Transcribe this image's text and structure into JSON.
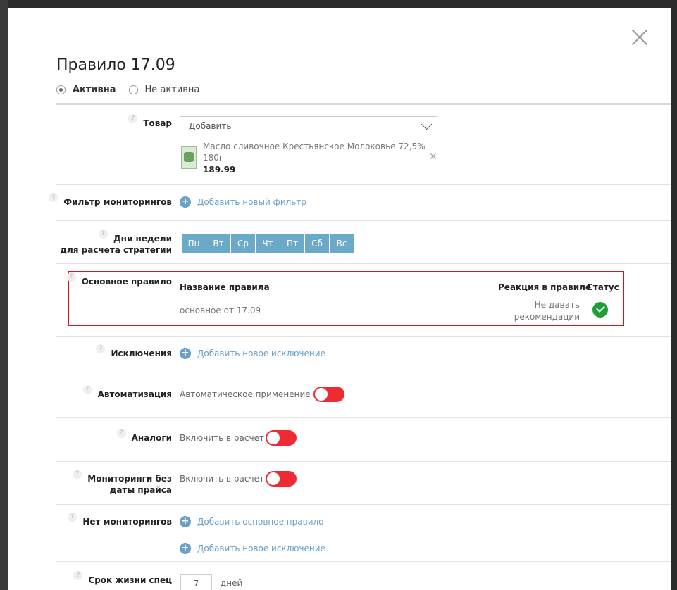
{
  "modal": {
    "title": "Правило 17.09",
    "status_options": [
      {
        "label": "Активна",
        "selected": true
      },
      {
        "label": "Не активна",
        "selected": false
      }
    ]
  },
  "product": {
    "label": "Товар",
    "select_placeholder": "Добавить",
    "name": "Масло сливочное Крестьянское Молоковье 72,5% 180г",
    "price": "189.99"
  },
  "monitoring_filter": {
    "label": "Фильтр мониторингов",
    "add_link": "Добавить новый фильтр"
  },
  "weekdays": {
    "label_line1": "Дни недели",
    "label_line2": "для расчета стратегии",
    "days": [
      "Пн",
      "Вт",
      "Ср",
      "Чт",
      "Пт",
      "Сб",
      "Вс"
    ]
  },
  "main_rule": {
    "label": "Основное правило",
    "headers": {
      "name": "Название правила",
      "reaction": "Реакция в правиле",
      "status": "Статус"
    },
    "row": {
      "name": "основное от 17.09",
      "reaction_line1": "Не давать",
      "reaction_line2": "рекомендации"
    },
    "highlight_color": "#e0101c",
    "status_color": "#1e9e36"
  },
  "exceptions": {
    "label": "Исключения",
    "add_link": "Добавить новое исключение"
  },
  "automation": {
    "label": "Автоматизация",
    "text": "Автоматическое применение",
    "enabled": false
  },
  "analogs": {
    "label": "Аналоги",
    "text": "Включить в расчет",
    "enabled": false
  },
  "monitorings_no_date": {
    "label_line1": "Мониторинги без",
    "label_line2": "даты прайса",
    "text": "Включить в расчет",
    "enabled": false
  },
  "no_monitorings": {
    "label": "Нет мониторингов",
    "add_main_rule": "Добавить основное правило",
    "add_exception": "Добавить новое исключение"
  },
  "lifetime": {
    "label": "Срок жизни спец",
    "value": "7",
    "unit": "дней"
  },
  "colors": {
    "accent": "#6a9fc8",
    "toggle": "#ee2b32",
    "day_button": "#6aa9c8"
  }
}
